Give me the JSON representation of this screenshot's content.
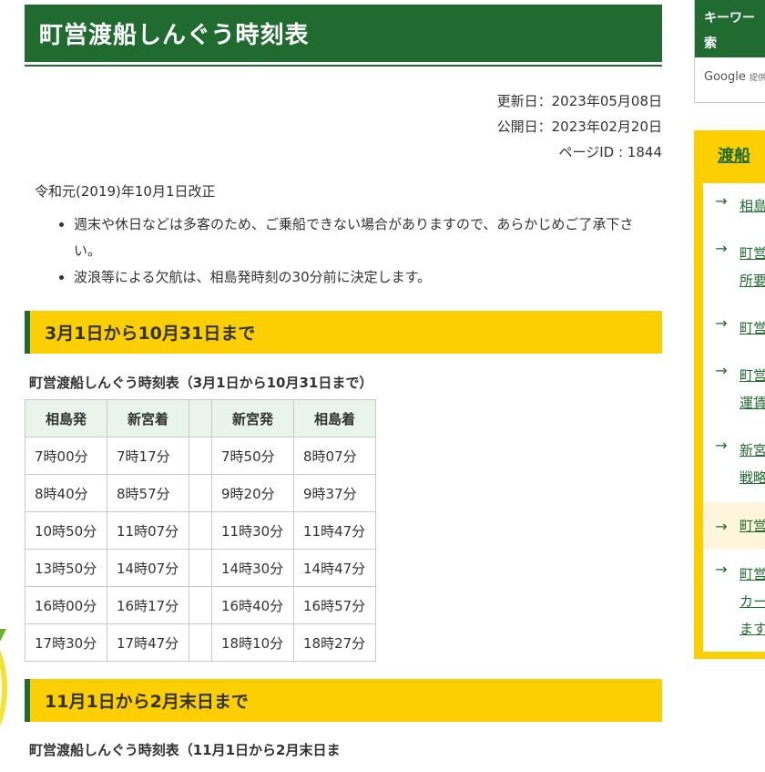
{
  "page": {
    "title": "町営渡船しんぐう時刻表",
    "updated": "更新日：2023年05月08日",
    "published": "公開日：2023年02月20日",
    "page_id": "ページID : 1844",
    "revision": "令和元(2019)年10月1日改正",
    "notes": [
      "週末や休日などは多客のため、ご乗船できない場合がありますので、あらかじめご了承下さい。",
      "波浪等による欠航は、相島発時刻の30分前に決定します。"
    ]
  },
  "section1": {
    "heading": "3月1日から10月31日まで",
    "caption": "町営渡船しんぐう時刻表（3月1日から10月31日まで）",
    "headers": [
      "相島発",
      "新宮着",
      "",
      "新宮発",
      "相島着"
    ],
    "rows": [
      [
        "7時00分",
        "7時17分",
        "",
        "7時50分",
        "8時07分"
      ],
      [
        "8時40分",
        "8時57分",
        "",
        "9時20分",
        "9時37分"
      ],
      [
        "10時50分",
        "11時07分",
        "",
        "11時30分",
        "11時47分"
      ],
      [
        "13時50分",
        "14時07分",
        "",
        "14時30分",
        "14時47分"
      ],
      [
        "16時00分",
        "16時17分",
        "",
        "16時40分",
        "16時57分"
      ],
      [
        "17時30分",
        "17時47分",
        "",
        "18時10分",
        "18時27分"
      ]
    ]
  },
  "section2": {
    "heading": "11月1日から2月末日まで",
    "caption": "町営渡船しんぐう時刻表（11月1日から2月末日ま"
  },
  "sidebar": {
    "search_label": "キーワー\n索",
    "search_line1": "キーワー",
    "search_line2": "索",
    "google": "Google",
    "google_suffix": "提供",
    "nav_title": "渡船",
    "nav_items": [
      {
        "line1": "相島",
        "line2": ""
      },
      {
        "line1": "町営",
        "line2": "所要"
      },
      {
        "line1": "町営",
        "line2": ""
      },
      {
        "line1": "町営",
        "line2": "運賃"
      },
      {
        "line1": "新宮",
        "line2": "戦略"
      },
      {
        "line1": "町営",
        "line2": ""
      },
      {
        "line1": "町営",
        "line2": "カー",
        "line3": "ます"
      }
    ]
  },
  "colors": {
    "brand_green": "#1f6b30",
    "accent_yellow": "#fccf02",
    "table_header_bg": "#e8f4ec"
  }
}
